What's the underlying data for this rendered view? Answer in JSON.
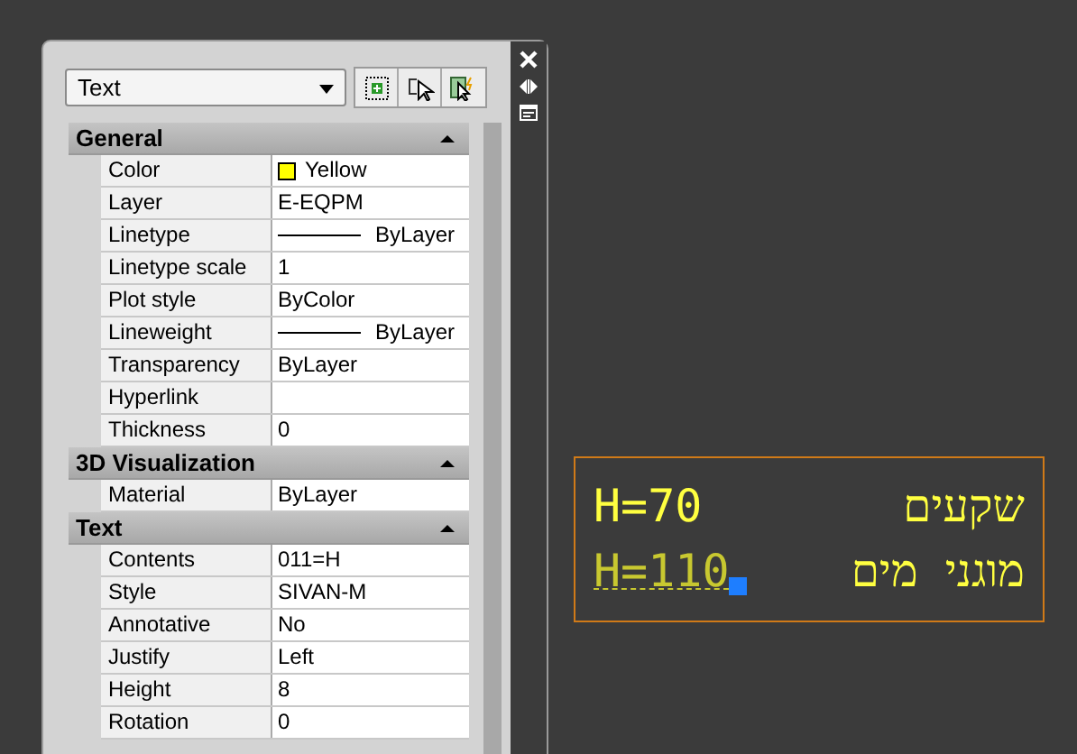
{
  "palette": {
    "object_type": "Text"
  },
  "sections": [
    {
      "title": "General",
      "expanded": true,
      "rows": [
        {
          "kind": "color",
          "label": "Color",
          "value": "Yellow",
          "color": "#ffff00"
        },
        {
          "kind": "text",
          "label": "Layer",
          "value": "E-EQPM"
        },
        {
          "kind": "line",
          "label": "Linetype",
          "value": "ByLayer"
        },
        {
          "kind": "text",
          "label": "Linetype scale",
          "value": "1"
        },
        {
          "kind": "text",
          "label": "Plot style",
          "value": "ByColor"
        },
        {
          "kind": "line",
          "label": "Lineweight",
          "value": "ByLayer"
        },
        {
          "kind": "text",
          "label": "Transparency",
          "value": "ByLayer"
        },
        {
          "kind": "text",
          "label": "Hyperlink"
        },
        {
          "kind": "text",
          "label": "Thickness",
          "value": "0"
        }
      ]
    },
    {
      "title": "3D Visualization",
      "expanded": true,
      "rows": [
        {
          "kind": "text",
          "label": "Material",
          "value": "ByLayer"
        }
      ]
    },
    {
      "title": "Text",
      "expanded": true,
      "rows": [
        {
          "kind": "text",
          "label": "Contents",
          "value": "011=H"
        },
        {
          "kind": "text",
          "label": "Style",
          "value": "SIVAN-M"
        },
        {
          "kind": "text",
          "label": "Annotative",
          "value": "No"
        },
        {
          "kind": "text",
          "label": "Justify",
          "value": "Left"
        },
        {
          "kind": "text",
          "label": "Height",
          "value": "8"
        },
        {
          "kind": "text",
          "label": "Rotation",
          "value": "0"
        }
      ]
    }
  ],
  "drawing": {
    "texts": [
      {
        "text": "H=70",
        "selected": false
      },
      {
        "text": "שקעים",
        "selected": false
      },
      {
        "text": "H=110",
        "selected": true
      },
      {
        "text": "מוגני מים",
        "selected": false
      }
    ]
  }
}
